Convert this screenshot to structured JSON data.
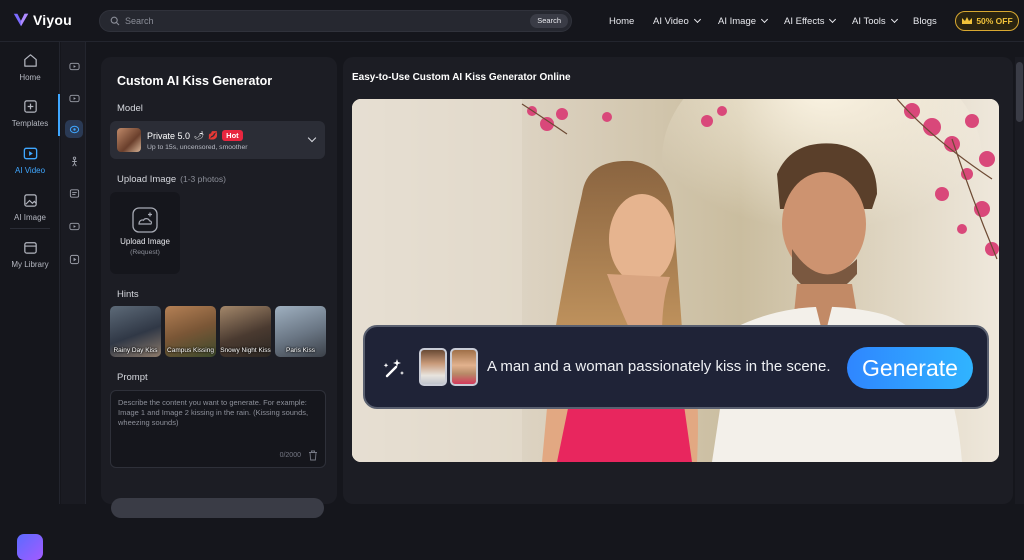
{
  "header": {
    "logo_text": "Viyou",
    "search_placeholder": "Search",
    "search_button": "Search",
    "nav": [
      {
        "label": "Home"
      },
      {
        "label": "AI Video"
      },
      {
        "label": "AI Image"
      },
      {
        "label": "AI Effects"
      },
      {
        "label": "AI Tools"
      },
      {
        "label": "Blogs"
      }
    ],
    "promo": "50% OFF"
  },
  "rail": {
    "items": [
      {
        "label": "Home"
      },
      {
        "label": "Templates"
      },
      {
        "label": "AI Video"
      },
      {
        "label": "AI Image"
      },
      {
        "label": "My Library"
      }
    ]
  },
  "panel": {
    "title": "Custom AI Kiss Generator",
    "model_label": "Model",
    "model_name": "Private 5.0",
    "model_badge": "Hot",
    "model_desc": "Up to 15s, uncensored, smoother",
    "upload_label": "Upload Image",
    "upload_sub_label": "(1-3 photos)",
    "upload_title": "Upload Image",
    "upload_sub": "(Request)",
    "hints_label": "Hints",
    "hints": [
      {
        "label": "Rainy Day Kiss"
      },
      {
        "label": "Campus Kissing"
      },
      {
        "label": "Snowy Night Kiss"
      },
      {
        "label": "Paris Kiss"
      }
    ],
    "prompt_label": "Prompt",
    "prompt_placeholder": "Describe the content you want to generate. For example: Image 1 and Image 2 kissing in the rain. (Kissing sounds, wheezing sounds)",
    "counter": "0/2000"
  },
  "main": {
    "title": "Easy-to-Use Custom AI Kiss Generator Online",
    "hero_prompt": "A man and a woman passionately kiss in the scene.",
    "generate_label": "Generate"
  },
  "colors": {
    "accent": "#3fa7ff",
    "hot": "#e8263f",
    "promo": "#f0c23a"
  }
}
